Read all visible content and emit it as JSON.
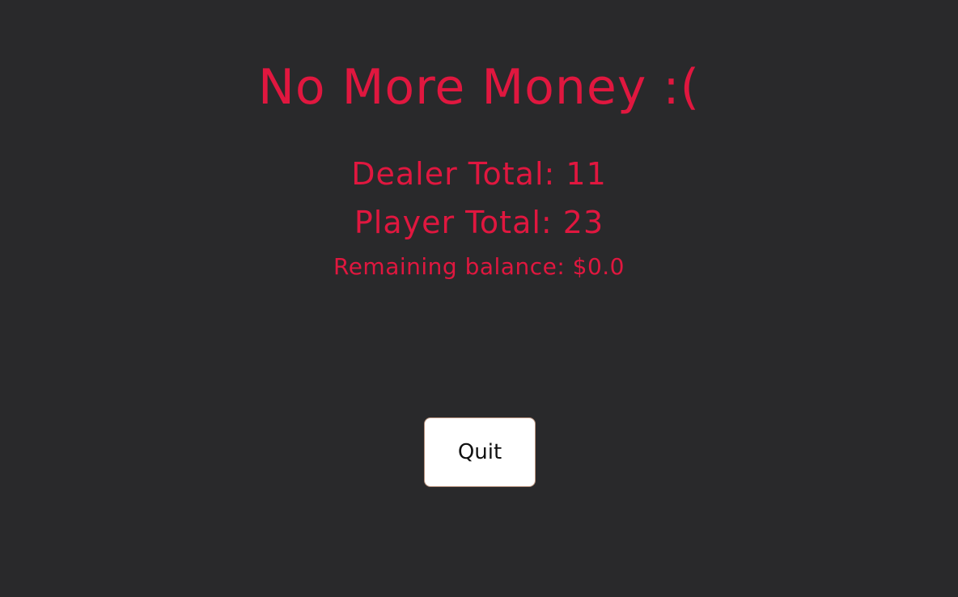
{
  "screen": {
    "title": "No More Money :(",
    "dealer_total": "Dealer Total: 11",
    "player_total": "Player Total: 23",
    "remaining_balance": "Remaining balance: $0.0",
    "quit_label": "Quit"
  },
  "colors": {
    "background": "#29292b",
    "text_accent": "#e0173f",
    "button_background": "#ffffff",
    "button_text": "#111111",
    "button_border": "#b8927d"
  }
}
